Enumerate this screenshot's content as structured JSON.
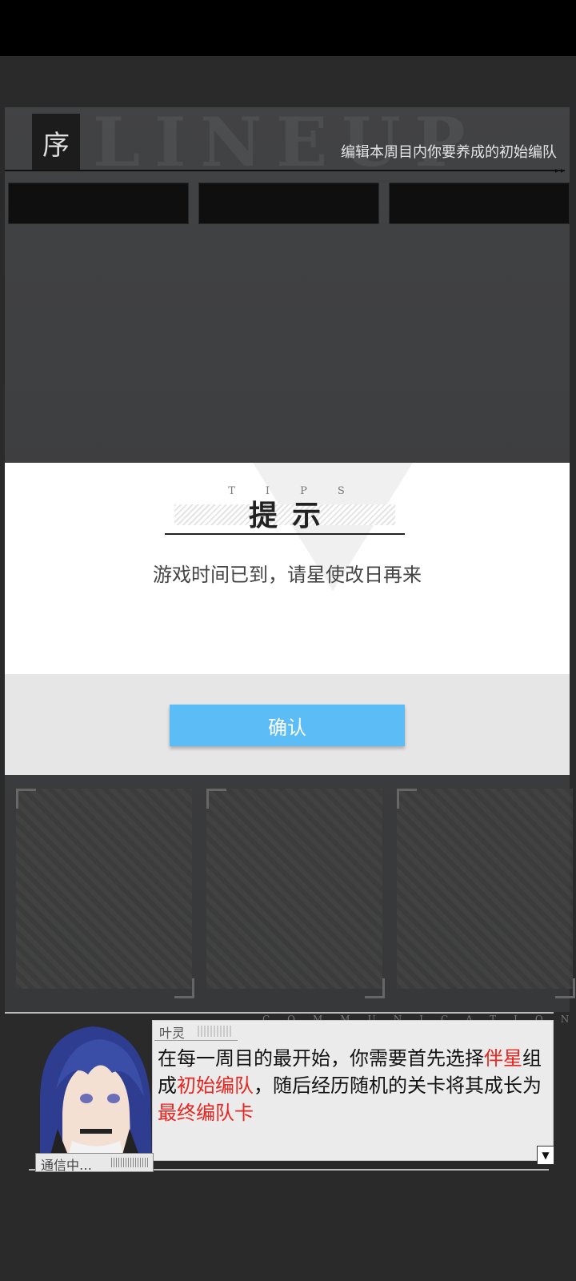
{
  "header": {
    "seal_char": "序",
    "bg_letters": "LINEUP",
    "subtitle": "编辑本周目内你要养成的初始编队"
  },
  "modal": {
    "tips_en": "TIPS",
    "title": "提示",
    "message": "游戏时间已到，请星使改日再来",
    "confirm_label": "确认"
  },
  "dialog": {
    "comm_label": "COMMUNICATION",
    "speaker": "叶灵",
    "text_segments": [
      {
        "text": "在每一周目的最开始，你需要首先选择",
        "highlight": false
      },
      {
        "text": "伴星",
        "highlight": true
      },
      {
        "text": "组成",
        "highlight": false
      },
      {
        "text": "初始编队",
        "highlight": true
      },
      {
        "text": "，随后经历随机的关卡将其成长为",
        "highlight": false
      },
      {
        "text": "最终编队卡",
        "highlight": true
      }
    ],
    "status": "通信中…",
    "scroll_icon": "double-chevron-down-icon"
  },
  "colors": {
    "accent": "#5bbcf6",
    "highlight": "#e8251f"
  }
}
